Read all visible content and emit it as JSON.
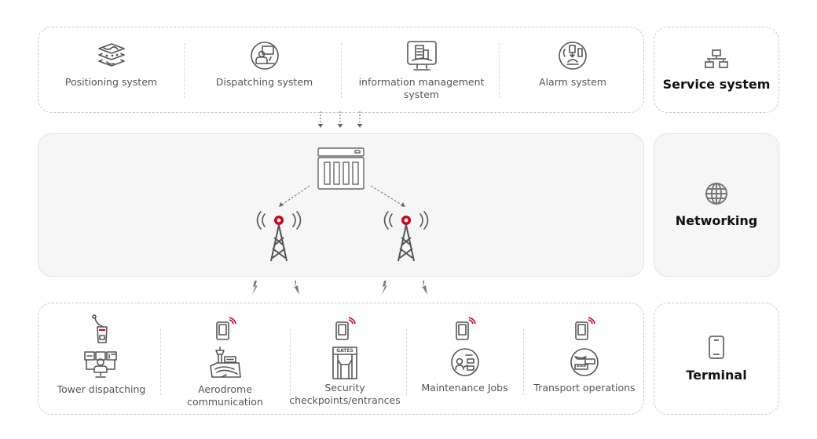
{
  "service_system": {
    "title": "Service system",
    "icon": "network-topology-icon",
    "items": [
      {
        "label": "Positioning system",
        "icon": "layered-map-icon"
      },
      {
        "label": "Dispatching system",
        "icon": "dispatcher-icon"
      },
      {
        "label": "information management system",
        "icon": "building-monitor-icon"
      },
      {
        "label": "Alarm system",
        "icon": "alarm-icon"
      }
    ]
  },
  "networking": {
    "title": "Networking",
    "icon": "globe-icon",
    "nodes": [
      {
        "name": "core-server",
        "icon": "server-icon"
      },
      {
        "name": "base-station-left",
        "icon": "signal-tower-icon"
      },
      {
        "name": "base-station-right",
        "icon": "signal-tower-icon"
      }
    ]
  },
  "terminal": {
    "title": "Terminal",
    "icon": "smartphone-icon",
    "items": [
      {
        "label": "Tower dispatching",
        "icon": "radio-handset-icon",
        "scene_icon": "control-room-icon"
      },
      {
        "label": "Aerodrome communication",
        "icon": "tablet-wireless-icon",
        "scene_icon": "airport-tower-icon"
      },
      {
        "label": "Security checkpoints/entrances",
        "icon": "tablet-wireless-icon",
        "scene_icon": "gates-icon",
        "gate_text": "GATES"
      },
      {
        "label": "Maintenance Jobs",
        "icon": "tablet-wireless-icon",
        "scene_icon": "maintenance-worker-icon"
      },
      {
        "label": "Transport operations",
        "icon": "tablet-wireless-icon",
        "scene_icon": "transport-vehicles-icon"
      }
    ]
  },
  "colors": {
    "accent": "#d0021b",
    "icon_gray": "#555555",
    "panel_fill": "#f6f6f6",
    "dashed_border": "#c8c8c8"
  }
}
